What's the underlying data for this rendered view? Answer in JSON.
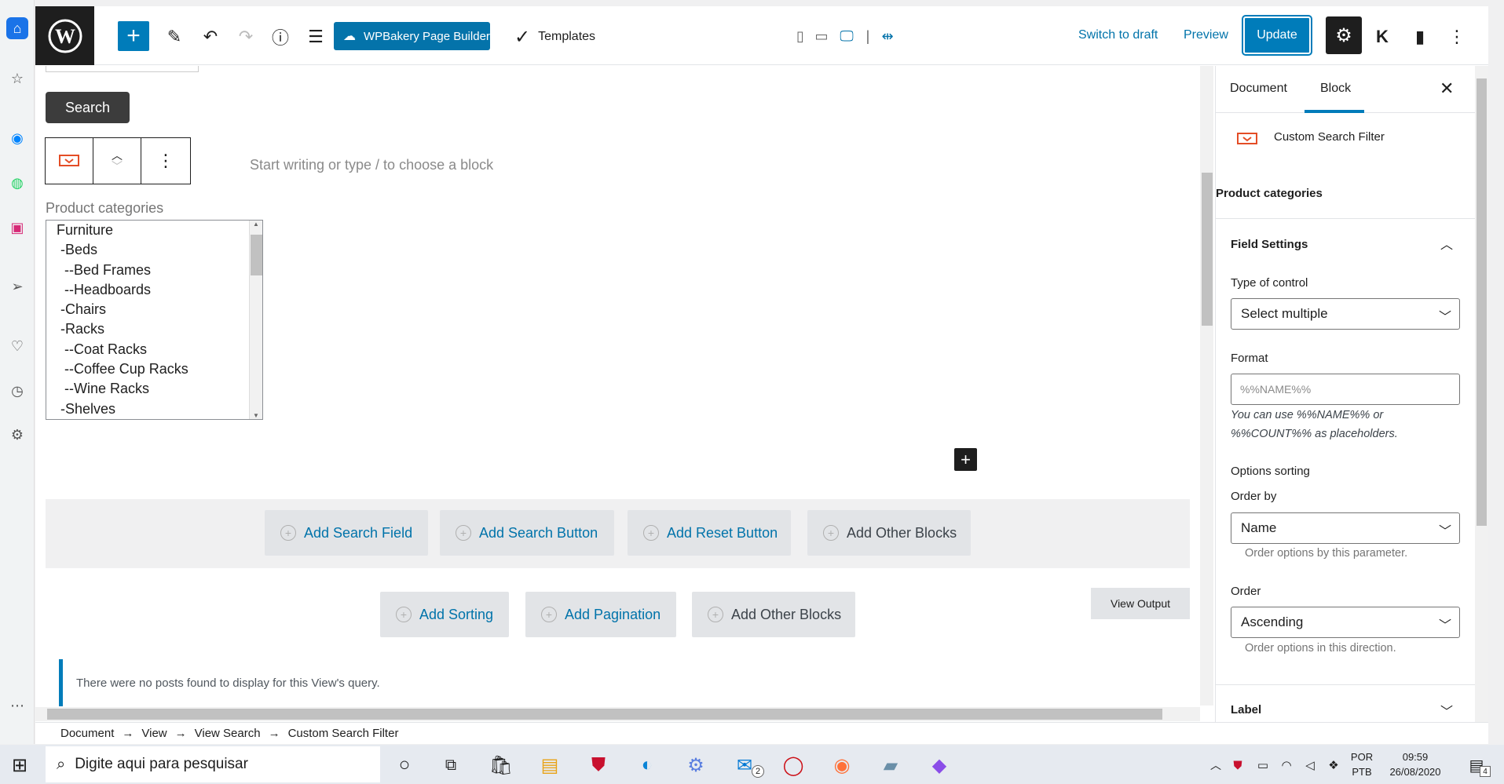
{
  "topbar": {
    "wpbakery_label": "WPBakery Page Builder",
    "templates_label": "Templates",
    "switch_to_draft": "Switch to draft",
    "preview": "Preview",
    "update": "Update"
  },
  "main": {
    "search_button": "Search",
    "placeholder": "Start writing or type / to choose a block",
    "product_categories_label": "Product categories",
    "categories": [
      "Furniture",
      " -Beds",
      "  --Bed Frames",
      "  --Headboards",
      " -Chairs",
      " -Racks",
      "  --Coat Racks",
      "  --Coffee Cup Racks",
      "  --Wine Racks",
      " -Shelves"
    ],
    "row1_buttons": [
      "Add Search Field",
      "Add Search Button",
      "Add Reset Button",
      "Add Other Blocks"
    ],
    "row2_buttons": [
      "Add Sorting",
      "Add Pagination",
      "Add Other Blocks"
    ],
    "view_output": "View Output",
    "notice": "There were no posts found to display for this View's query."
  },
  "breadcrumb": [
    "Document",
    "View",
    "View Search",
    "Custom Search Filter"
  ],
  "breadcrumb_sep": "→",
  "sidebar": {
    "tab_document": "Document",
    "tab_block": "Block",
    "block_title": "Custom Search Filter",
    "block_subtitle": "Product categories",
    "field_settings": "Field Settings",
    "type_of_control_label": "Type of control",
    "type_of_control_value": "Select multiple",
    "format_label": "Format",
    "format_placeholder": "%%NAME%%",
    "format_help_1": "You can use %%NAME%% or",
    "format_help_2": "%%COUNT%% as placeholders.",
    "options_sorting": "Options sorting",
    "order_by_label": "Order by",
    "order_by_value": "Name",
    "order_by_help": "Order options by this parameter.",
    "order_label": "Order",
    "order_value": "Ascending",
    "order_help": "Order options in this direction.",
    "label_section": "Label"
  },
  "taskbar": {
    "search_placeholder": "Digite aqui para pesquisar",
    "lang_top": "POR",
    "lang_bottom": "PTB",
    "time": "09:59",
    "date": "26/08/2020",
    "mail_badge": "2",
    "notif_badge": "4"
  },
  "colors": {
    "accent": "#007cba",
    "wpbakery": "#0473aa",
    "dark": "#1e1e1e"
  }
}
